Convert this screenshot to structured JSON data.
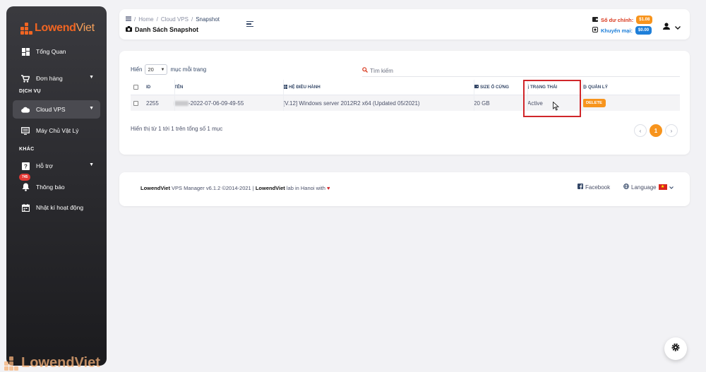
{
  "brand": {
    "name_part1": "Lowend",
    "name_part2": "Viet"
  },
  "sidebar": {
    "items": [
      {
        "label": "Tổng Quan",
        "icon": "dashboard-icon"
      },
      {
        "label": "Đơn hàng",
        "icon": "cart-icon"
      },
      {
        "label": "Cloud VPS",
        "icon": "cloud-icon"
      },
      {
        "label": "Máy Chủ Vật Lý",
        "icon": "server-icon"
      },
      {
        "label": "Hỗ trợ",
        "icon": "help-icon"
      },
      {
        "label": "Thông báo",
        "icon": "bell-icon",
        "badge": "745"
      },
      {
        "label": "Nhật kí hoạt động",
        "icon": "calendar-icon"
      }
    ],
    "section_services": "DỊCH VỤ",
    "section_other": "KHÁC"
  },
  "header": {
    "breadcrumb": [
      "Home",
      "Cloud VPS",
      "Snapshot"
    ],
    "title": "Danh Sách Snapshot",
    "balance_label": "Số dư chính:",
    "balance_value": "$1.08",
    "promo_label": "Khuyến mại:",
    "promo_value": "$0.00"
  },
  "table_controls": {
    "show_prefix": "Hiển",
    "page_size": "20",
    "show_suffix": "mục mỗi trang",
    "search_placeholder": "Tìm kiếm"
  },
  "table": {
    "columns": {
      "id": "ID",
      "name": "TÊN",
      "os": "HỆ ĐIỀU HÀNH",
      "size": "SIZE Ổ CỨNG",
      "status": "TRẠNG THÁI",
      "actions": "QUẢN LÝ"
    },
    "rows": [
      {
        "id": "2255",
        "name_suffix": "-2022-07-06-09-49-55",
        "os": "[V.12] Windows server 2012R2 x64 (Updated 05/2021)",
        "size": "20 GB",
        "status": "Active",
        "action": "DELETE"
      }
    ]
  },
  "table_footer": {
    "info": "Hiển thị từ 1 tới 1 trên tổng số 1 mục",
    "prev": "‹",
    "current_page": "1",
    "next": "›"
  },
  "footer": {
    "brand": "LowendViet",
    "text1": " VPS Manager v6.1.2 ©2014-2021 | ",
    "brand2": "LowendViet",
    "text2": " lab in Hanoi with ",
    "heart": "♥",
    "facebook": "Facebook",
    "language": "Language"
  },
  "colors": {
    "accent": "#f7941d",
    "brand_orange": "#f26522",
    "danger": "#d0262a",
    "link_blue": "#1e7fd9"
  }
}
